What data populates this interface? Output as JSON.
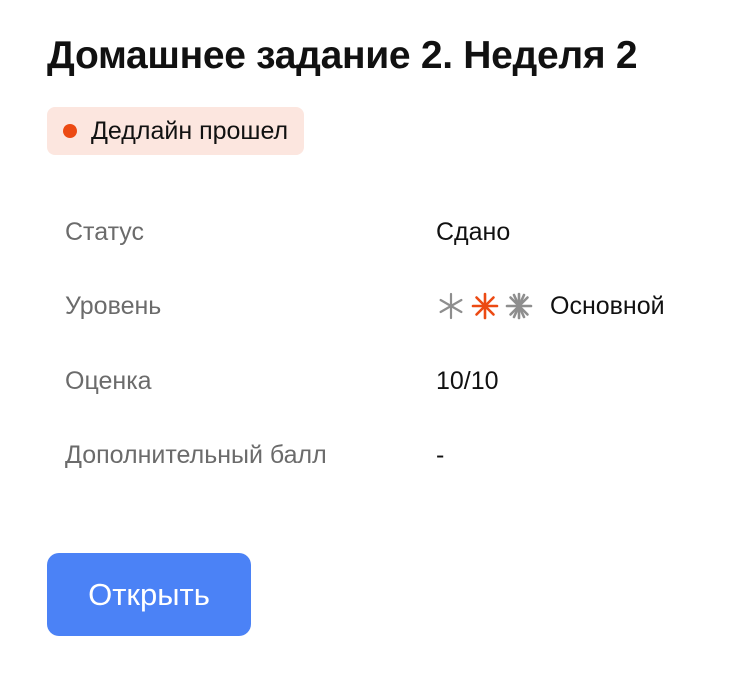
{
  "assignment": {
    "title": "Домашнее задание 2. Неделя 2",
    "deadline_badge": {
      "label": "Дедлайн прошел",
      "color": "#ec4a13",
      "background": "#fce6df"
    },
    "details": {
      "status": {
        "label": "Статус",
        "value": "Сдано"
      },
      "level": {
        "label": "Уровень",
        "value": "Основной",
        "icons": [
          "asterisk-icon-gray",
          "asterisk-icon-active",
          "asterisk-icon-gray-bold"
        ],
        "active_color": "#ec4a13",
        "inactive_color": "#8e8e8e"
      },
      "grade": {
        "label": "Оценка",
        "value": "10/10"
      },
      "bonus": {
        "label": "Дополнительный балл",
        "value": "-"
      }
    },
    "open_button": {
      "label": "Открыть",
      "color": "#4b82f6"
    }
  }
}
